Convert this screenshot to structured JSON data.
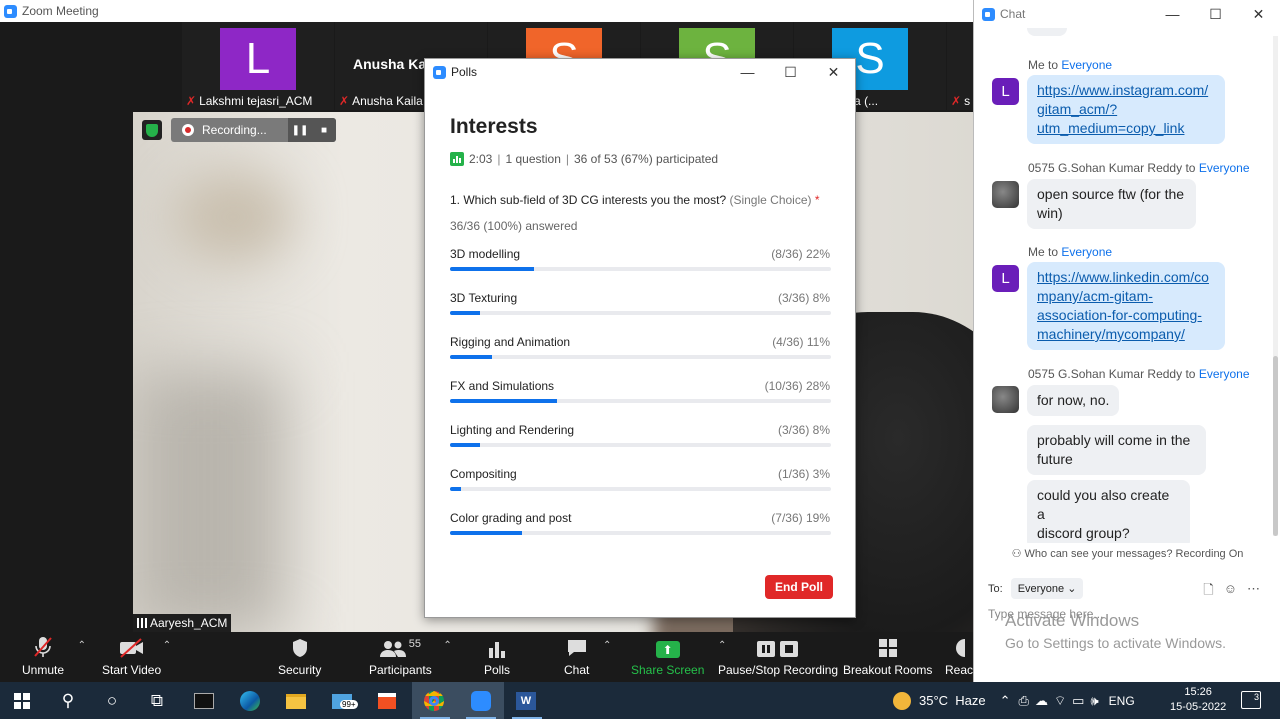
{
  "window": {
    "title": "Zoom Meeting"
  },
  "thumbnails": [
    {
      "initial": "L",
      "color": "#8e27c6",
      "name": "Lakshmi tejasri_ACM"
    },
    {
      "initial": "",
      "color": "",
      "big_name": "Anusha Ka",
      "name": "Anusha Kaila"
    },
    {
      "initial": "S",
      "color": "#f0652a",
      "name": ""
    },
    {
      "initial": "S",
      "color": "#6db33f",
      "name": ""
    },
    {
      "initial": "S",
      "color": "#0e9be0",
      "name": "nnalagedda (..."
    }
  ],
  "recording": {
    "label": "Recording..."
  },
  "main_video": {
    "name": "Aaryesh_ACM"
  },
  "toolbar": {
    "unmute": "Unmute",
    "start_video": "Start Video",
    "security": "Security",
    "participants": "Participants",
    "participants_count": "55",
    "polls": "Polls",
    "chat": "Chat",
    "share_screen": "Share Screen",
    "pause_recording": "Pause/Stop Recording",
    "breakout_rooms": "Breakout Rooms",
    "reactions": "Reacti"
  },
  "poll": {
    "window_title": "Polls",
    "title": "Interests",
    "time": "2:03",
    "questions": "1 question",
    "participation": "36 of 53 (67%) participated",
    "question": "1. Which sub-field of 3D CG interests you the most?",
    "question_type": "(Single Choice)",
    "required_mark": "*",
    "answered": "36/36 (100%) answered",
    "options": [
      {
        "label": "3D modelling",
        "result": "(8/36) 22%",
        "percent": 22
      },
      {
        "label": "3D Texturing",
        "result": "(3/36) 8%",
        "percent": 8
      },
      {
        "label": "Rigging and Animation",
        "result": "(4/36) 11%",
        "percent": 11
      },
      {
        "label": "FX and Simulations",
        "result": "(10/36) 28%",
        "percent": 28
      },
      {
        "label": "Lighting and Rendering",
        "result": "(3/36) 8%",
        "percent": 8
      },
      {
        "label": "Compositing",
        "result": "(1/36) 3%",
        "percent": 3
      },
      {
        "label": "Color grading and post",
        "result": "(7/36) 19%",
        "percent": 19
      }
    ],
    "end_button": "End Poll"
  },
  "chat": {
    "title": "Chat",
    "messages": [
      {
        "from": "Me",
        "to_word": "to",
        "to": "Everyone",
        "avatar": "L",
        "text": "https://www.instagram.com/\ngitam_acm/?\nutm_medium=copy_link",
        "link": true
      },
      {
        "from": "0575 G.Sohan Kumar Reddy",
        "to_word": "to",
        "to": "Everyone",
        "avatar": "",
        "text": "open source ftw (for the\nwin)",
        "link": false
      },
      {
        "from": "Me",
        "to_word": "to",
        "to": "Everyone",
        "avatar": "L",
        "text": "https://www.linkedin.com/co\nmpany/acm-gitam-\nassociation-for-computing-\nmachinery/mycompany/",
        "link": true
      },
      {
        "from": "0575 G.Sohan Kumar Reddy",
        "to_word": "to",
        "to": "Everyone",
        "avatar": "",
        "text": "for now, no.",
        "link": false
      },
      {
        "from": "",
        "to_word": "",
        "to": "",
        "avatar": "",
        "text": "probably will come in the\nfuture",
        "link": false
      },
      {
        "from": "",
        "to_word": "",
        "to": "",
        "avatar": "",
        "text": "could you also create a\ndiscord group?",
        "link": false
      }
    ],
    "visibility_note": "Who can see your messages? Recording On",
    "to_label": "To:",
    "to_value": "Everyone",
    "input_placeholder": "Type message here..."
  },
  "watermark": {
    "line1": "Activate Windows",
    "line2": "Go to Settings to activate Windows."
  },
  "taskbar": {
    "weather": "35°C  Haze",
    "lang": "ENG",
    "time": "15:26",
    "date": "15-05-2022",
    "mail_badge": "99+",
    "notifications": "3"
  }
}
